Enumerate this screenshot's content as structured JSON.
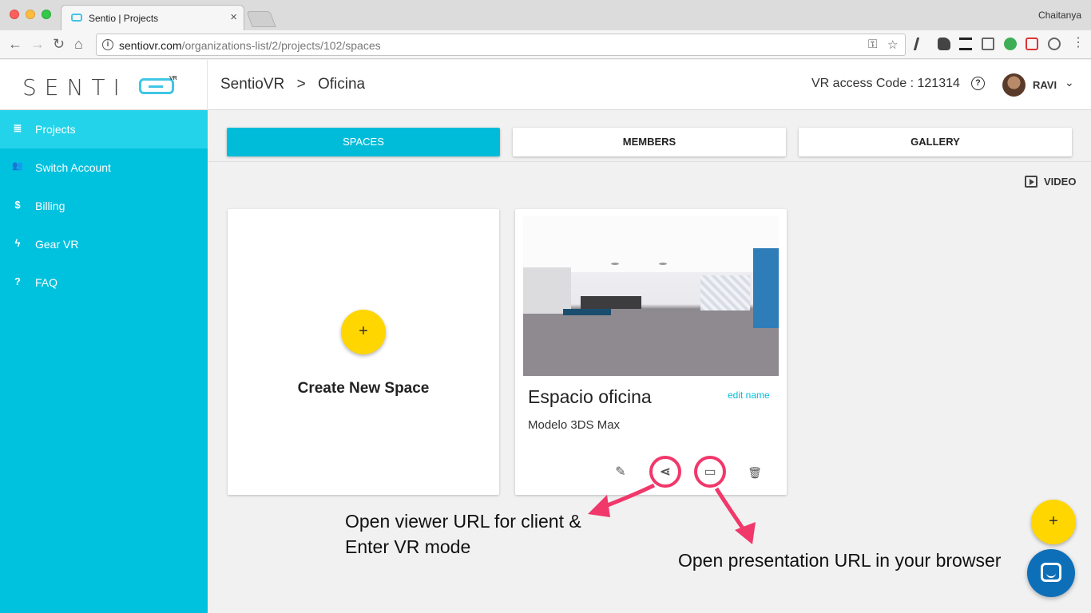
{
  "browser": {
    "tab_title": "Sentio | Projects",
    "tab_close": "×",
    "profile": "Chaitanya",
    "url_host": "sentiovr.com",
    "url_path": "/organizations-list/2/projects/102/spaces",
    "info_glyph": "i",
    "back_glyph": "←",
    "forward_glyph": "→",
    "reload_glyph": "↻",
    "home_glyph": "⌂",
    "key_glyph": "⚿",
    "star_glyph": "☆"
  },
  "header": {
    "logo_text": "SENTI",
    "logo_vr": "VR",
    "breadcrumb_root": "SentioVR",
    "breadcrumb_sep": ">",
    "breadcrumb_current": "Oficina",
    "vr_access_code": "VR access Code : 121314",
    "help_glyph": "?",
    "user_name": "RAVI",
    "user_chevron": "⌄"
  },
  "sidebar": {
    "items": [
      {
        "label": "Projects",
        "icon": "list-icon",
        "glyph": "≣"
      },
      {
        "label": "Switch Account",
        "icon": "users-icon",
        "glyph": "👥"
      },
      {
        "label": "Billing",
        "icon": "dollar-icon",
        "glyph": "$"
      },
      {
        "label": "Gear VR",
        "icon": "bolt-icon",
        "glyph": "ϟ"
      },
      {
        "label": "FAQ",
        "icon": "question-icon",
        "glyph": "?"
      }
    ]
  },
  "tabs": [
    {
      "label": "SPACES",
      "active": true
    },
    {
      "label": "MEMBERS",
      "active": false
    },
    {
      "label": "GALLERY",
      "active": false
    }
  ],
  "video_label": "VIDEO",
  "create_card": {
    "plus": "+",
    "label": "Create New Space"
  },
  "space_card": {
    "title": "Espacio oficina",
    "edit_label": "edit name",
    "model": "Modelo 3DS Max",
    "actions": {
      "edit_glyph": "✎",
      "share_glyph": "⋖",
      "cast_glyph": "▭",
      "delete_glyph": "🗑"
    }
  },
  "annotations": {
    "share_line1": "Open viewer URL for client &",
    "share_line2": "Enter VR mode",
    "cast": "Open presentation URL in your browser",
    "color": "#f0386b"
  },
  "fab": {
    "plus": "+"
  },
  "colors": {
    "sidebar": "#00c1de",
    "accent": "#00bcd9",
    "fab": "#ffd600",
    "chat": "#0d6fb8"
  }
}
